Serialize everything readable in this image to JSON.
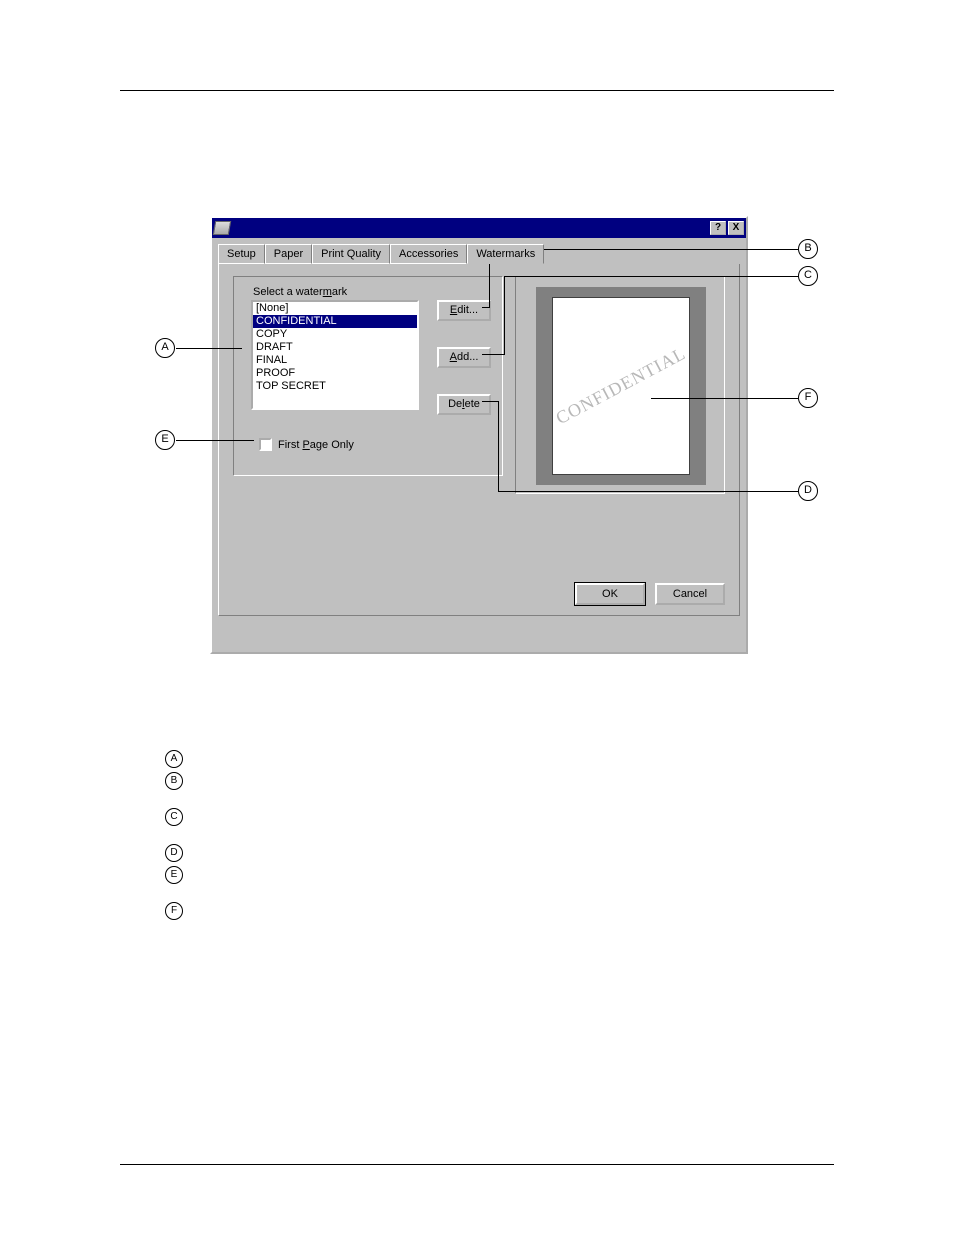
{
  "dialog": {
    "titlebar": {
      "help_btn": "?",
      "close_btn": "X"
    },
    "tabs": {
      "setup": "Setup",
      "paper": "Paper",
      "print_quality": "Print Quality",
      "accessories": "Accessories",
      "watermarks": "Watermarks"
    },
    "select_label_pre": "Select a water",
    "select_label_u": "m",
    "select_label_post": "ark",
    "list_items": [
      "[None]",
      "CONFIDENTIAL",
      "COPY",
      "DRAFT",
      "FINAL",
      "PROOF",
      "TOP SECRET"
    ],
    "selected_index": 1,
    "buttons": {
      "edit_u": "E",
      "edit_rest": "dit...",
      "add_u": "A",
      "add_rest": "dd...",
      "delete_pre": "De",
      "delete_u": "l",
      "delete_post": "ete"
    },
    "first_page_pre": "First ",
    "first_page_u": "P",
    "first_page_post": "age Only",
    "preview_watermark": "CONFIDENTIAL",
    "ok": "OK",
    "cancel": "Cancel"
  },
  "callouts": {
    "A": "A",
    "B": "B",
    "C": "C",
    "D": "D",
    "E": "E",
    "F": "F"
  }
}
